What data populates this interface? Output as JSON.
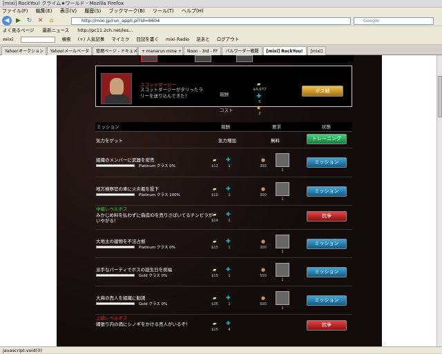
{
  "window": {
    "title": "[mixi] RockYou! クライム★ワールド - Mozilla Firefox"
  },
  "menu": [
    "ファイル(F)",
    "編集(E)",
    "表示(V)",
    "履歴(S)",
    "ブックマーク(B)",
    "ツール(T)",
    "ヘルプ(H)"
  ],
  "nav": {
    "url": "http://mixi.jp/run_appli.pl?id=6604",
    "search_placeholder": "Google"
  },
  "bookmarks": [
    "よく見るページ",
    "最新ニュース",
    "http://pc11.2ch.net/les..."
  ],
  "toolbar2": {
    "items": [
      "mixi",
      "検索",
      "(+) 人気記事",
      "マイミク",
      "日記を書く",
      "mixi Radio",
      "足あと",
      "ログアウト"
    ]
  },
  "tabs": [
    {
      "label": "Yahoo!オークション"
    },
    {
      "label": "Yahoo!メールベータ"
    },
    {
      "label": "管理ページ - ドキュメント"
    },
    {
      "label": "+ manarun mine +"
    },
    {
      "label": "Noon - 3rd - FF"
    },
    {
      "label": "パルワーダー戦闘"
    },
    {
      "label": "[mixi] RockYou!"
    },
    {
      "label": "[mixi]"
    }
  ],
  "boss": {
    "name": "スコットダージー",
    "desc": "スコットダージーがタリったラリーを送り込んできた！",
    "reward_label": "報酬",
    "cost_label": "コスト",
    "money": "$4,977",
    "exp": "5",
    "cost": "2",
    "button": "ボス戦"
  },
  "header": {
    "mission": "ミッション",
    "reward": "報酬",
    "required": "要求",
    "status": "状態"
  },
  "missions": [
    {
      "type": "plain",
      "name": "気力をゲット",
      "reward_text": "気力増加",
      "req_text": "無料",
      "button": "トレーニング"
    },
    {
      "type": "normal",
      "name": "組織のメンバーに武器を密売",
      "class": "Platinum クラス 0%",
      "progress": 0,
      "money": "$12",
      "exp": "1",
      "req": "350",
      "item": "1",
      "button": "ミッション"
    },
    {
      "type": "normal",
      "name": "地方検察官の車に火炎瓶を投下",
      "class": "Platinum クラス 100%",
      "progress": 1,
      "money": "$10",
      "exp": "1",
      "req": "300",
      "item": "1",
      "button": "ミッション"
    },
    {
      "type": "boss",
      "label": "中級レベルボス",
      "name": "みかじめ料を払わずに偽造IDを売りさばいてるチンピラがいやがる！",
      "money": "$14",
      "exp": "2",
      "button": "抗争"
    },
    {
      "type": "normal",
      "name": "大地主の建物を不法占拠",
      "class": "Platinum クラス 0%",
      "progress": 0,
      "money": "$15",
      "exp": "1",
      "req": "300",
      "item": "1",
      "button": "ミッション"
    },
    {
      "type": "normal",
      "name": "派手なパーティでボスの誕生日を祝福",
      "class": "Gold クラス 0%",
      "progress": 0,
      "money": "$15",
      "exp": "1",
      "req": "550",
      "item": "1",
      "button": "ミッション"
    },
    {
      "type": "normal",
      "name": "大麻の売人を組織に勧誘",
      "class": "Gold クラス 0%",
      "progress": 0,
      "money": "$35",
      "exp": "1",
      "req": "500",
      "item": "1",
      "button": "ミッション"
    },
    {
      "type": "boss-hard",
      "label": "上級レベルボス",
      "name": "縄張り内の酒にシノギをかける売人がいるぞ！",
      "money": "$15",
      "exp": "4",
      "button": "抗争"
    }
  ],
  "status": "javascript:void(0)"
}
